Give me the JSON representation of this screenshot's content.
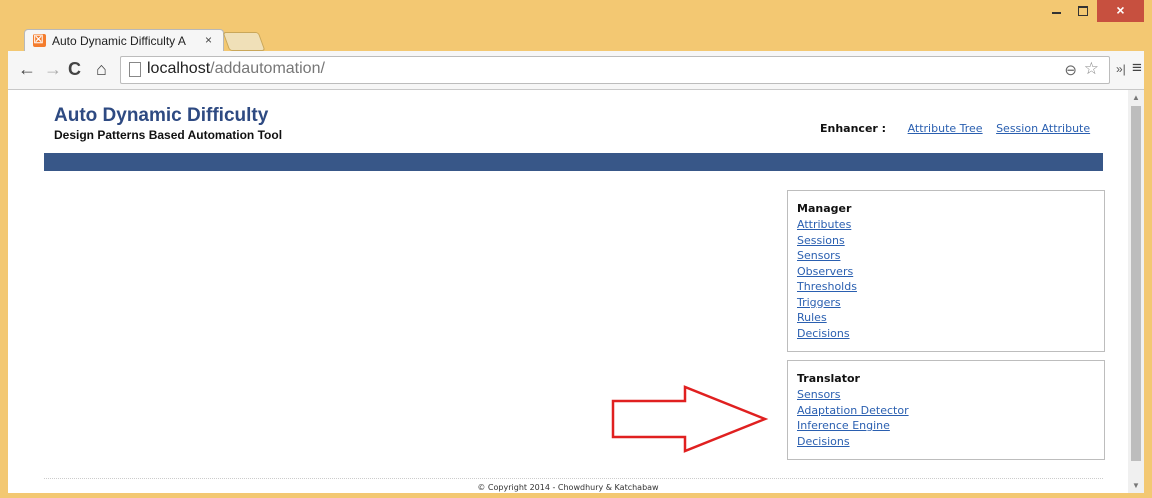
{
  "browser": {
    "tab_title": "Auto Dynamic Difficulty A",
    "tab_close": "×",
    "url_host": "localhost",
    "url_path": "/addautomation/",
    "close_glyph": "×"
  },
  "page": {
    "title": "Auto Dynamic Difficulty",
    "subtitle": "Design Patterns Based Automation Tool",
    "enhancer_label": "Enhancer :",
    "enhancer_links": [
      "Attribute Tree",
      "Session Attribute"
    ],
    "colors": {
      "banner": "#385788",
      "link": "#2a5fb0",
      "title": "#2e4a82",
      "arrow": "#e02020"
    }
  },
  "manager": {
    "heading": "Manager",
    "links": [
      "Attributes",
      "Sessions",
      "Sensors",
      "Observers",
      "Thresholds",
      "Triggers",
      "Rules",
      "Decisions"
    ]
  },
  "translator": {
    "heading": "Translator",
    "links": [
      "Sensors",
      "Adaptation Detector",
      "Inference Engine",
      "Decisions"
    ]
  },
  "footer": "© Copyright 2014 - Chowdhury & Katchabaw"
}
